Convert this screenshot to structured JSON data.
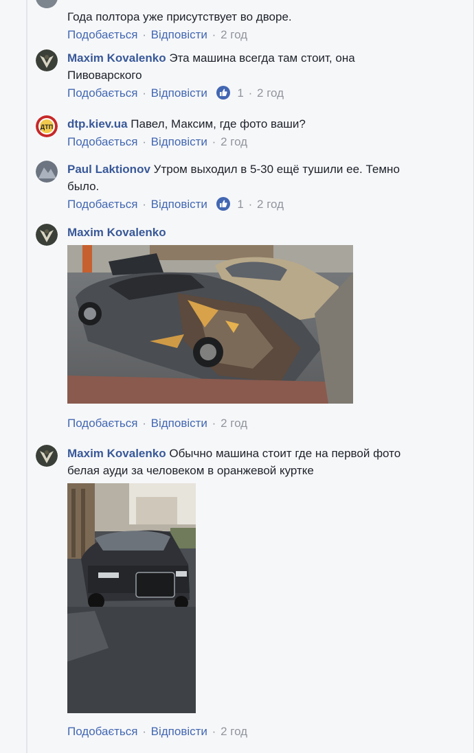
{
  "actions": {
    "like": "Подобається",
    "reply": "Відповісти",
    "separator": "·"
  },
  "comments": [
    {
      "author": "",
      "text": "Года полтора уже присутствует во дворе.",
      "time": "2 год",
      "likes": ""
    },
    {
      "author": "Maxim Kovalenko",
      "text": "Эта машина всегда там стоит, она",
      "text2": "Пивоварского",
      "time": "2 год",
      "likes": "1"
    },
    {
      "author": "dtp.kiev.ua",
      "text": "Павел, Максим, где фото ваши?",
      "time": "2 год",
      "likes": ""
    },
    {
      "author": "Paul Laktionov",
      "text": "Утром выходил в 5-30 ещё тушили ее. Темно",
      "text2": "было.",
      "time": "2 год",
      "likes": "1"
    },
    {
      "author": "Maxim Kovalenko",
      "text": "",
      "time": "2 год",
      "likes": ""
    },
    {
      "author": "Maxim Kovalenko",
      "text": "Обычно машина стоит где на первой фото",
      "text2": "белая ауди за человеком в оранжевой куртке",
      "time": "2 год",
      "likes": ""
    }
  ],
  "avatar_logo_text": "ДТП",
  "colors": {
    "link": "#4267b2",
    "author": "#385898",
    "meta": "#90949c",
    "background": "#f6f7f9"
  }
}
